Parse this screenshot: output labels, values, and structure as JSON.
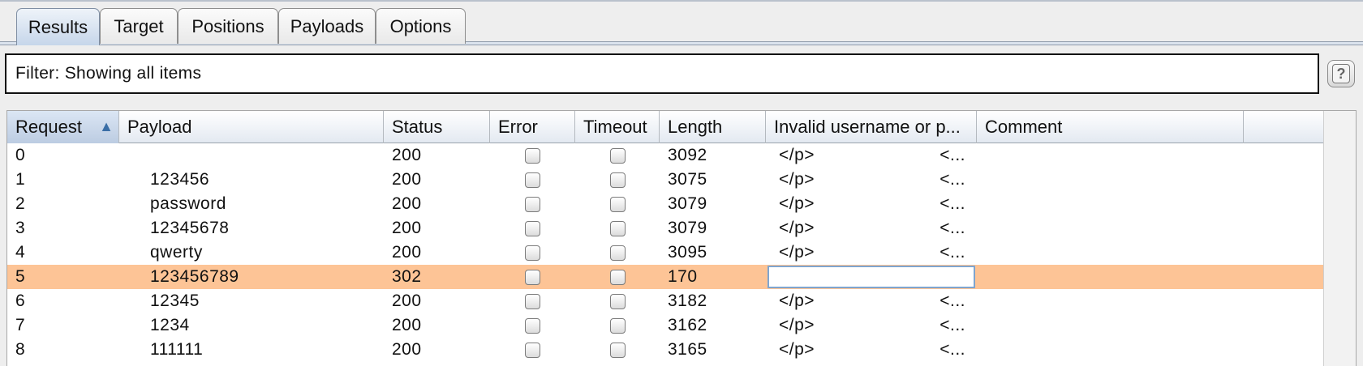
{
  "tabs": [
    {
      "label": "Results",
      "active": true
    },
    {
      "label": "Target",
      "active": false
    },
    {
      "label": "Positions",
      "active": false
    },
    {
      "label": "Payloads",
      "active": false
    },
    {
      "label": "Options",
      "active": false
    }
  ],
  "filter": {
    "text": "Filter: Showing all items"
  },
  "help": {
    "label": "?"
  },
  "table": {
    "columns": [
      "Request",
      "Payload",
      "Status",
      "Error",
      "Timeout",
      "Length",
      "Invalid username or p...",
      "Comment"
    ],
    "sort": {
      "column": "Request",
      "direction": "ascending",
      "arrow": "▲"
    },
    "rows": [
      {
        "request": "0",
        "payload": "",
        "status": "200",
        "error": false,
        "timeout": false,
        "length": "3092",
        "inv_a": "</p>",
        "inv_b": "<...",
        "comment": "",
        "selected": false
      },
      {
        "request": "1",
        "payload": "123456",
        "status": "200",
        "error": false,
        "timeout": false,
        "length": "3075",
        "inv_a": "</p>",
        "inv_b": "<...",
        "comment": "",
        "selected": false
      },
      {
        "request": "2",
        "payload": "password",
        "status": "200",
        "error": false,
        "timeout": false,
        "length": "3079",
        "inv_a": "</p>",
        "inv_b": "<...",
        "comment": "",
        "selected": false
      },
      {
        "request": "3",
        "payload": "12345678",
        "status": "200",
        "error": false,
        "timeout": false,
        "length": "3079",
        "inv_a": "</p>",
        "inv_b": "<...",
        "comment": "",
        "selected": false
      },
      {
        "request": "4",
        "payload": "qwerty",
        "status": "200",
        "error": false,
        "timeout": false,
        "length": "3095",
        "inv_a": "</p>",
        "inv_b": "<...",
        "comment": "",
        "selected": false
      },
      {
        "request": "5",
        "payload": "123456789",
        "status": "302",
        "error": false,
        "timeout": false,
        "length": "170",
        "inv_a": "",
        "inv_b": "",
        "comment": "",
        "selected": true
      },
      {
        "request": "6",
        "payload": "12345",
        "status": "200",
        "error": false,
        "timeout": false,
        "length": "3182",
        "inv_a": "</p>",
        "inv_b": "<...",
        "comment": "",
        "selected": false
      },
      {
        "request": "7",
        "payload": "1234",
        "status": "200",
        "error": false,
        "timeout": false,
        "length": "3162",
        "inv_a": "</p>",
        "inv_b": "<...",
        "comment": "",
        "selected": false
      },
      {
        "request": "8",
        "payload": "111111",
        "status": "200",
        "error": false,
        "timeout": false,
        "length": "3165",
        "inv_a": "</p>",
        "inv_b": "<...",
        "comment": "",
        "selected": false
      }
    ]
  },
  "colors": {
    "selected_row": "#fdc496",
    "active_tab": "#c6d6ea",
    "sort_arrow": "#3a6ea6"
  }
}
